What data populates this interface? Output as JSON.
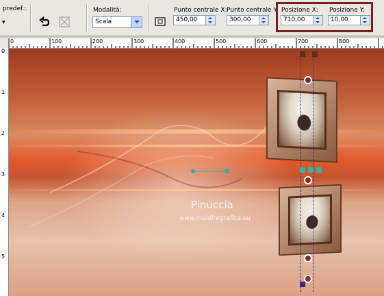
{
  "toolbar": {
    "preset_label": "predef.:",
    "modality_label": "Modalità:",
    "modality_value": "Scala",
    "center_x_label": "Punto centrale X:",
    "center_x_value": "450,00",
    "center_y_label": "Punto centrale Y:",
    "center_y_value": "300,00",
    "pos_x_label": "Posizione X:",
    "pos_x_value": "710,00",
    "pos_y_label": "Posizione Y:",
    "pos_y_value": "10,00"
  },
  "ruler": {
    "top_ticks": [
      "0",
      "100",
      "200",
      "300",
      "400",
      "500",
      "600",
      "700",
      "800"
    ],
    "left_ticks": [
      "0",
      "1",
      "2",
      "3",
      "4",
      "5"
    ]
  },
  "canvas": {
    "watermark_name": "Pinuccia",
    "watermark_url": "www.maidiregrafica.eu"
  },
  "colors": {
    "highlight_border": "#7b1e20",
    "toolbar_bg": "#e9e7e0",
    "handle": "#2fb3a6"
  },
  "icons": [
    "undo-icon",
    "reset-icon",
    "chevron-down-icon",
    "center-icon"
  ]
}
